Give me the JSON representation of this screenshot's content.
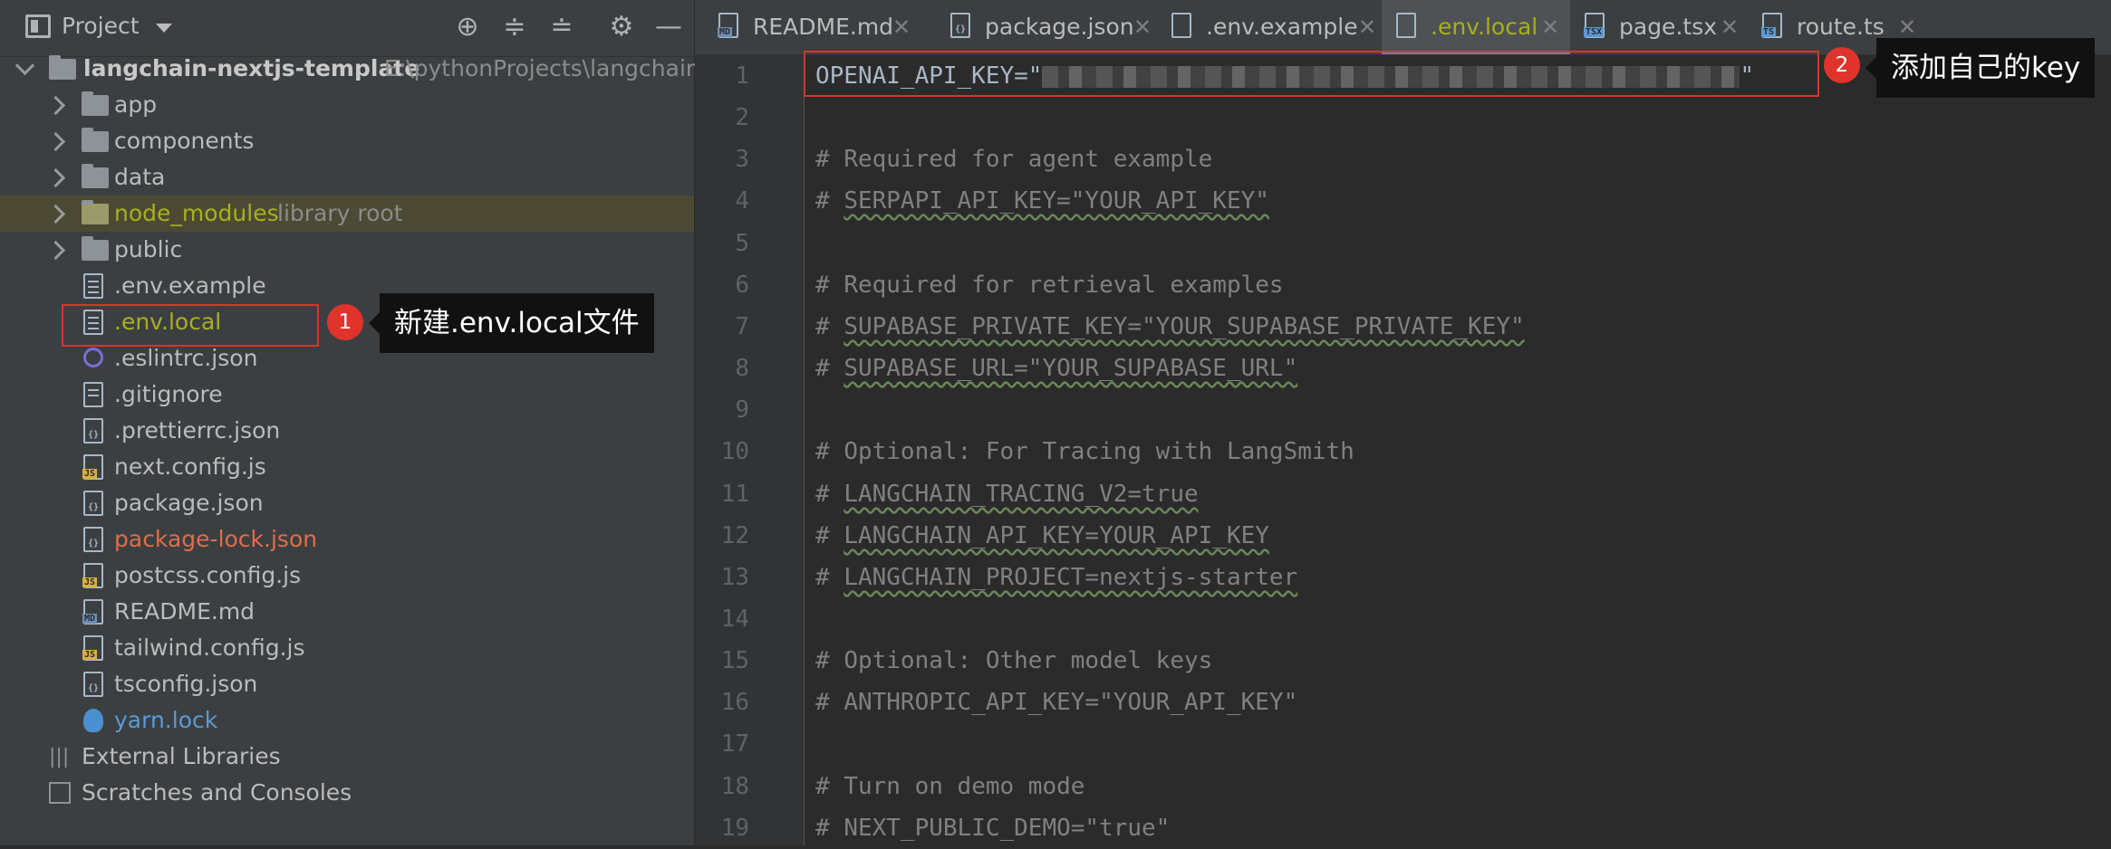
{
  "project_panel": {
    "title": "Project",
    "tree": [
      {
        "label": "langchain-nextjs-template",
        "hint": "E:\\pythonProjects\\langchain-n",
        "type": "root"
      },
      {
        "label": "app",
        "type": "folder"
      },
      {
        "label": "components",
        "type": "folder"
      },
      {
        "label": "data",
        "type": "folder"
      },
      {
        "label": "node_modules",
        "hint": "library root",
        "type": "folder"
      },
      {
        "label": "public",
        "type": "folder"
      },
      {
        "label": ".env.example",
        "type": "file"
      },
      {
        "label": ".env.local",
        "type": "file"
      },
      {
        "label": ".eslintrc.json",
        "type": "file"
      },
      {
        "label": ".gitignore",
        "type": "file"
      },
      {
        "label": ".prettierrc.json",
        "type": "file"
      },
      {
        "label": "next.config.js",
        "type": "file"
      },
      {
        "label": "package.json",
        "type": "file"
      },
      {
        "label": "package-lock.json",
        "type": "file"
      },
      {
        "label": "postcss.config.js",
        "type": "file"
      },
      {
        "label": "README.md",
        "type": "file"
      },
      {
        "label": "tailwind.config.js",
        "type": "file"
      },
      {
        "label": "tsconfig.json",
        "type": "file"
      },
      {
        "label": "yarn.lock",
        "type": "file"
      },
      {
        "label": "External Libraries",
        "type": "special"
      },
      {
        "label": "Scratches and Consoles",
        "type": "special"
      }
    ]
  },
  "tabs": [
    {
      "label": "README.md",
      "badge": "MD"
    },
    {
      "label": "package.json",
      "badge": "{}"
    },
    {
      "label": ".env.example",
      "badge": ""
    },
    {
      "label": ".env.local",
      "badge": "",
      "active": true
    },
    {
      "label": "page.tsx",
      "badge": "TSX"
    },
    {
      "label": "route.ts",
      "badge": "TS"
    }
  ],
  "editor": {
    "line_numbers": [
      "1",
      "2",
      "3",
      "4",
      "5",
      "6",
      "7",
      "8",
      "9",
      "10",
      "11",
      "12",
      "13",
      "14",
      "15",
      "16",
      "17",
      "18",
      "19"
    ],
    "lines": [
      {
        "pre": "OPENAI_API_KEY=\"",
        "secret": true,
        "post": "\""
      },
      {
        "text": ""
      },
      {
        "hash": "# ",
        "text": "Required for agent example"
      },
      {
        "hash": "# ",
        "text": "SERPAPI_API_KEY=\"YOUR_API_KEY\"",
        "squiggle": "SERPAPI"
      },
      {
        "text": ""
      },
      {
        "hash": "# ",
        "text": "Required for retrieval examples"
      },
      {
        "hash": "# ",
        "text": "SUPABASE_PRIVATE_KEY=\"YOUR_SUPABASE_PRIVATE_KEY\"",
        "squiggle": "SUPABASE"
      },
      {
        "hash": "# ",
        "text": "SUPABASE_URL=\"YOUR_SUPABASE_URL\"",
        "squiggle": "SUPABASE"
      },
      {
        "text": ""
      },
      {
        "hash": "# ",
        "text": "Optional: For Tracing with LangSmith"
      },
      {
        "hash": "# ",
        "text": "LANGCHAIN_TRACING_V2=true",
        "squiggle": "LANGCHAIN"
      },
      {
        "hash": "# ",
        "text": "LANGCHAIN_API_KEY=YOUR_API_KEY",
        "squiggle": "LANGCHAIN"
      },
      {
        "hash": "# ",
        "text": "LANGCHAIN_PROJECT=nextjs-starter",
        "squiggle": "LANGCHAIN"
      },
      {
        "text": ""
      },
      {
        "hash": "# ",
        "text": "Optional: Other model keys"
      },
      {
        "hash": "# ",
        "text": "ANTHROPIC_API_KEY=\"YOUR_API_KEY\""
      },
      {
        "text": ""
      },
      {
        "hash": "# ",
        "text": "Turn on demo mode"
      },
      {
        "hash": "# ",
        "text": "NEXT_PUBLIC_DEMO=\"true\""
      }
    ]
  },
  "annotations": [
    {
      "number": "1",
      "text": "新建.env.local文件"
    },
    {
      "number": "2",
      "text": "添加自己的key"
    }
  ],
  "colors": {
    "accent": "#4a88c7",
    "annotation_red": "#e0332c",
    "library_root_yellow": "#a8b01c",
    "modified_red": "#e06c4c"
  }
}
